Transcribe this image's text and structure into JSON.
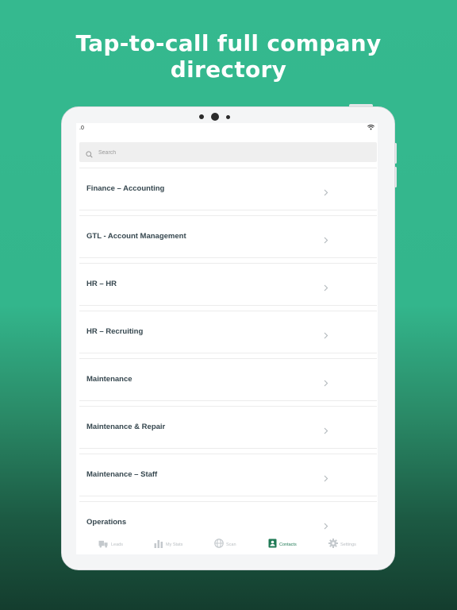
{
  "headline": {
    "line1": "Tap-to-call full company",
    "line2": "directory"
  },
  "status": {
    "time": ".0"
  },
  "search": {
    "placeholder": "Search"
  },
  "departments": [
    "Finance – Accounting",
    "GTL - Account Management",
    "HR – HR",
    "HR – Recruiting",
    "Maintenance",
    "Maintenance & Repair",
    "Maintenance – Staff",
    "Operations"
  ],
  "tabs": [
    {
      "label": "Leads",
      "icon": "truck-icon",
      "active": false
    },
    {
      "label": "My Stats",
      "icon": "bar-chart-icon",
      "active": false
    },
    {
      "label": "Scan",
      "icon": "globe-icon",
      "active": false
    },
    {
      "label": "Contacts",
      "icon": "contact-card-icon",
      "active": true
    },
    {
      "label": "Settings",
      "icon": "gear-icon",
      "active": false
    }
  ],
  "colors": {
    "background": "#35b98f",
    "active_tab": "#1f7a55",
    "text": "#36474f"
  }
}
